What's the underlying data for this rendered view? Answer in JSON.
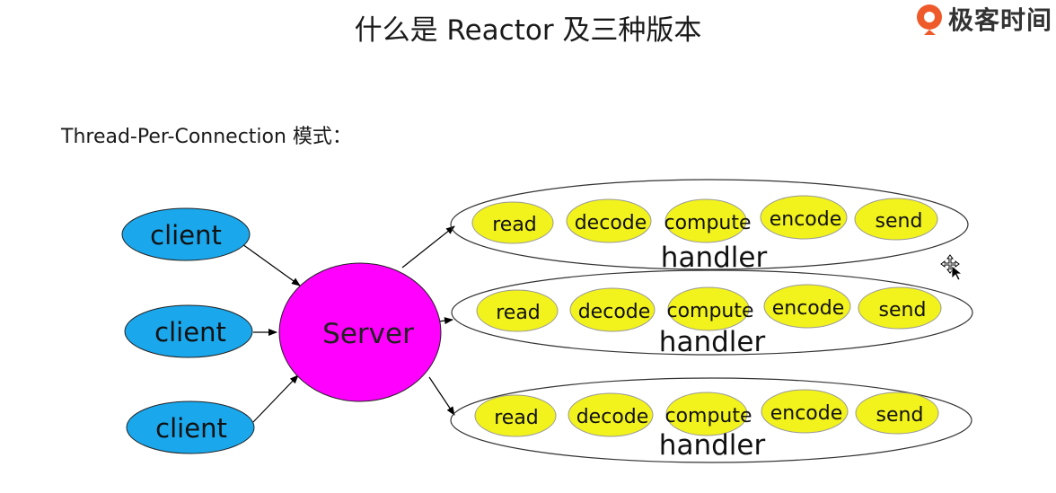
{
  "title": "什么是 Reactor 及三种版本",
  "logo": {
    "text": "极客时间"
  },
  "subtitle": "Thread-Per-Connection 模式：",
  "diagram": {
    "clients": [
      "client",
      "client",
      "client"
    ],
    "server": "Server",
    "handler_label": "handler",
    "steps": [
      "read",
      "decode",
      "compute",
      "encode",
      "send"
    ]
  },
  "colors": {
    "client_fill": "#1aa7ec",
    "server_fill": "#ff00ff",
    "step_fill": "#f2f21c",
    "outline": "#000000"
  }
}
